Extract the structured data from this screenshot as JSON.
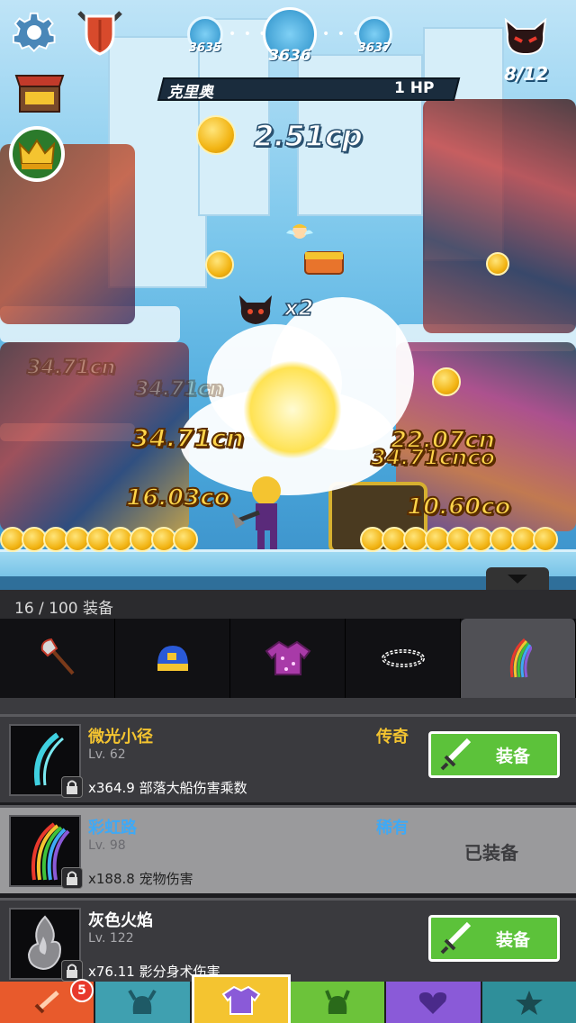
{
  "hud": {
    "stages": {
      "prev": "3635",
      "current": "3636",
      "next": "3637"
    },
    "wave_progress": "8/12",
    "boss": {
      "name": "克里奥",
      "hp": "1 HP"
    },
    "gold": "2.51cp",
    "multiplier": "x2"
  },
  "damage_numbers": [
    "34.71cn",
    "34.71cn",
    "34.71cn",
    "22.07cn",
    "34.71cnco",
    "16.03co",
    "10.60co"
  ],
  "equipment": {
    "count_label": "16 / 100 装备",
    "categories": [
      "axe-icon",
      "cap-icon",
      "shirt-icon",
      "wristband-icon",
      "rainbow-slash-icon"
    ],
    "active_category": 4,
    "items": [
      {
        "name": "微光小径",
        "level": "Lv. 62",
        "rarity": "传奇",
        "effect": "x364.9 部落大船伤害乘数",
        "action": "装备",
        "equipped": false
      },
      {
        "name": "彩虹路",
        "level": "Lv. 98",
        "rarity": "稀有",
        "effect": "x188.8 宠物伤害",
        "action": "已装备",
        "equipped": true
      },
      {
        "name": "灰色火焰",
        "level": "Lv. 122",
        "rarity": "",
        "effect": "x76.11 影分身术伤害",
        "action": "装备",
        "equipped": false
      }
    ]
  },
  "nav": {
    "tabs": [
      "sword-icon",
      "viking-helmet-icon",
      "shirt-icon",
      "horned-helmet-icon",
      "heart-icon",
      "star-icon"
    ],
    "badge": "5",
    "colors": [
      "#e85a2c",
      "#3fa0b0",
      "#f4c430",
      "#6cc33a",
      "#8a5ad8",
      "#2f8f9a"
    ]
  },
  "colors": {
    "gold": "#f4c430",
    "green_button": "#5cc23a",
    "rare_blue": "#3fa9f5"
  }
}
